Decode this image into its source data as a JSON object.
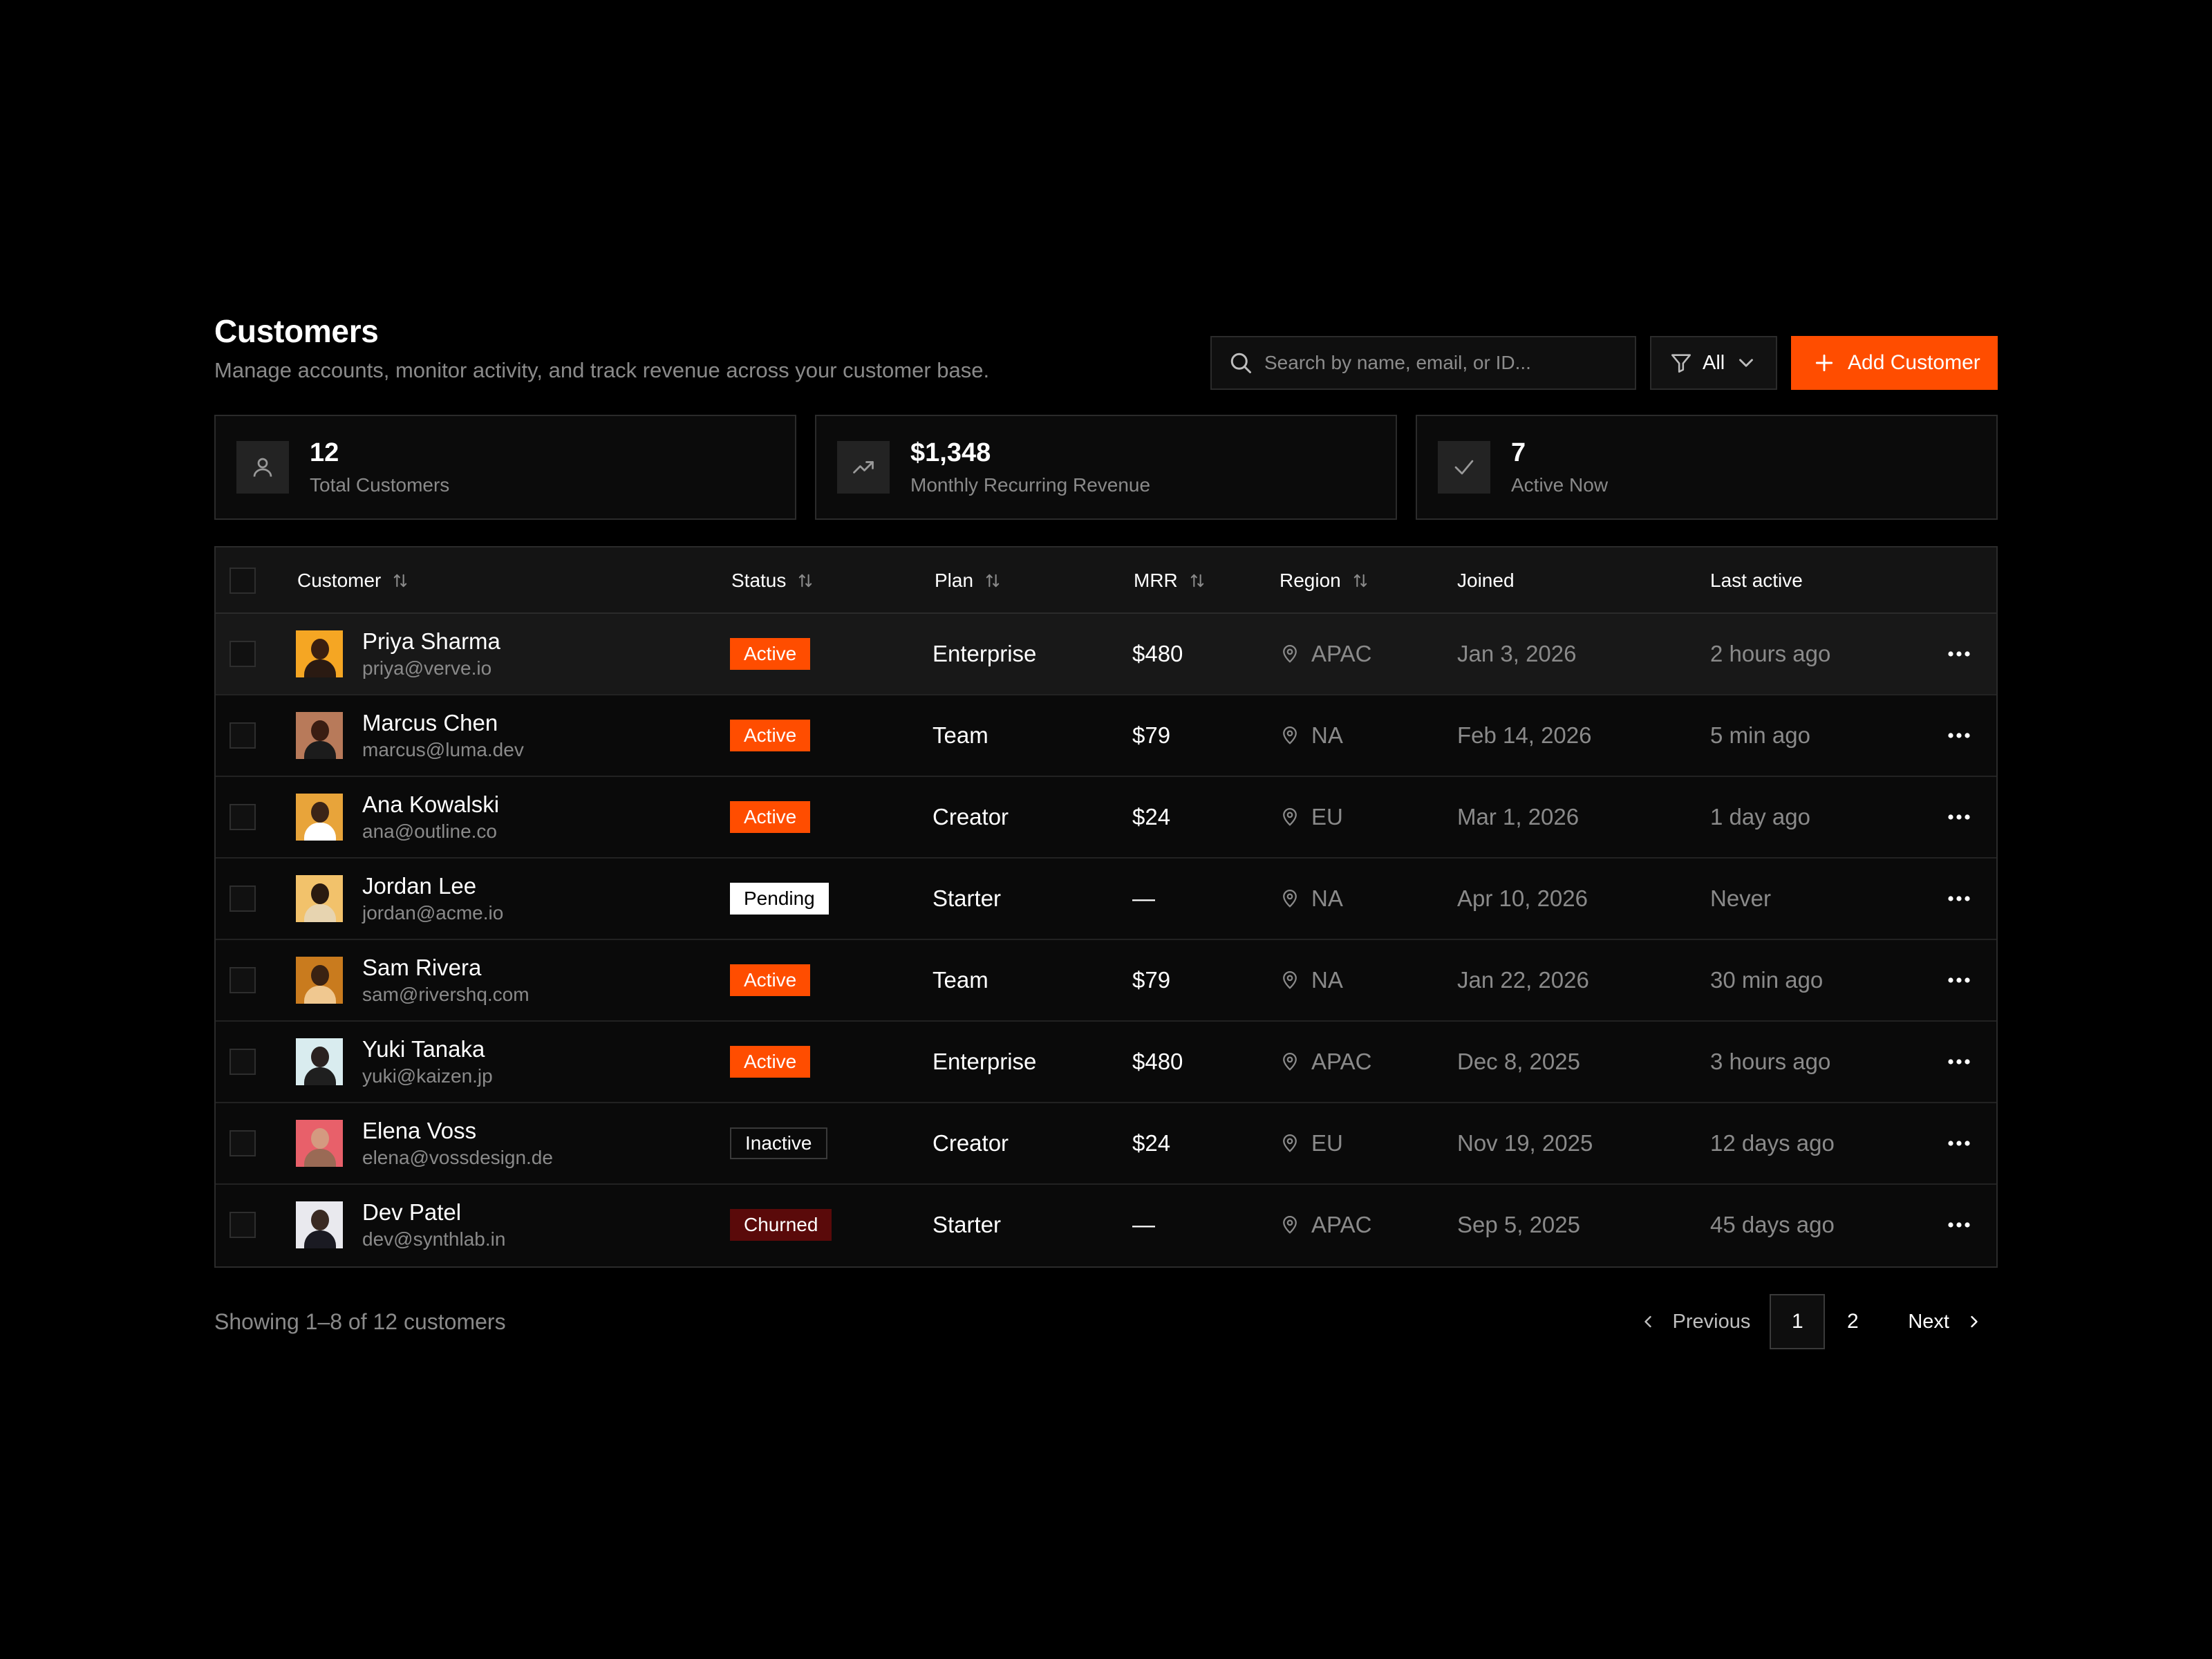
{
  "header": {
    "title": "Customers",
    "subtitle": "Manage accounts, monitor activity, and track revenue across your customer base."
  },
  "search": {
    "placeholder": "Search by name, email, or ID...",
    "value": ""
  },
  "filter": {
    "label": "All"
  },
  "add_button": {
    "label": "Add Customer"
  },
  "stats": [
    {
      "value": "12",
      "label": "Total Customers",
      "icon": "user-icon"
    },
    {
      "value": "$1,348",
      "label": "Monthly Recurring Revenue",
      "icon": "trending-up-icon"
    },
    {
      "value": "7",
      "label": "Active Now",
      "icon": "check-icon"
    }
  ],
  "table": {
    "columns": {
      "customer": "Customer",
      "status": "Status",
      "plan": "Plan",
      "mrr": "MRR",
      "region": "Region",
      "joined": "Joined",
      "last_active": "Last active"
    },
    "rows": [
      {
        "name": "Priya Sharma",
        "email": "priya@verve.io",
        "status": "Active",
        "plan": "Enterprise",
        "mrr": "$480",
        "region": "APAC",
        "joined": "Jan 3, 2026",
        "last_active": "2 hours ago"
      },
      {
        "name": "Marcus Chen",
        "email": "marcus@luma.dev",
        "status": "Active",
        "plan": "Team",
        "mrr": "$79",
        "region": "NA",
        "joined": "Feb 14, 2026",
        "last_active": "5 min ago"
      },
      {
        "name": "Ana Kowalski",
        "email": "ana@outline.co",
        "status": "Active",
        "plan": "Creator",
        "mrr": "$24",
        "region": "EU",
        "joined": "Mar 1, 2026",
        "last_active": "1 day ago"
      },
      {
        "name": "Jordan Lee",
        "email": "jordan@acme.io",
        "status": "Pending",
        "plan": "Starter",
        "mrr": "—",
        "region": "NA",
        "joined": "Apr 10, 2026",
        "last_active": "Never"
      },
      {
        "name": "Sam Rivera",
        "email": "sam@rivershq.com",
        "status": "Active",
        "plan": "Team",
        "mrr": "$79",
        "region": "NA",
        "joined": "Jan 22, 2026",
        "last_active": "30 min ago"
      },
      {
        "name": "Yuki Tanaka",
        "email": "yuki@kaizen.jp",
        "status": "Active",
        "plan": "Enterprise",
        "mrr": "$480",
        "region": "APAC",
        "joined": "Dec 8, 2025",
        "last_active": "3 hours ago"
      },
      {
        "name": "Elena Voss",
        "email": "elena@vossdesign.de",
        "status": "Inactive",
        "plan": "Creator",
        "mrr": "$24",
        "region": "EU",
        "joined": "Nov 19, 2025",
        "last_active": "12 days ago"
      },
      {
        "name": "Dev Patel",
        "email": "dev@synthlab.in",
        "status": "Churned",
        "plan": "Starter",
        "mrr": "—",
        "region": "APAC",
        "joined": "Sep 5, 2025",
        "last_active": "45 days ago"
      }
    ]
  },
  "pagination": {
    "showing": "Showing 1–8 of 12 customers",
    "previous": "Previous",
    "pages": [
      "1",
      "2"
    ],
    "current": "1",
    "next": "Next"
  },
  "colors": {
    "accent": "#ff4d00",
    "background": "#000000",
    "churned": "#5a0a0a"
  }
}
